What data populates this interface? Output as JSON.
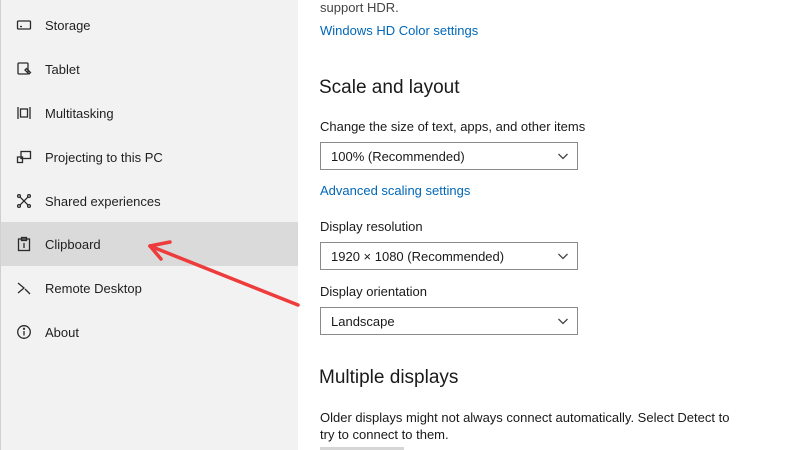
{
  "sidebar": {
    "items": [
      {
        "label": "Storage",
        "icon": "storage-icon"
      },
      {
        "label": "Tablet",
        "icon": "tablet-icon"
      },
      {
        "label": "Multitasking",
        "icon": "multitasking-icon"
      },
      {
        "label": "Projecting to this PC",
        "icon": "projecting-icon"
      },
      {
        "label": "Shared experiences",
        "icon": "shared-experiences-icon"
      },
      {
        "label": "Clipboard",
        "icon": "clipboard-icon"
      },
      {
        "label": "Remote Desktop",
        "icon": "remote-desktop-icon"
      },
      {
        "label": "About",
        "icon": "info-icon"
      }
    ],
    "selected": "Clipboard"
  },
  "main": {
    "hdr_text": "support HDR.",
    "hdr_link": "Windows HD Color settings",
    "scale_section": {
      "title": "Scale and layout",
      "size_label": "Change the size of text, apps, and other items",
      "size_value": "100% (Recommended)",
      "advanced_link": "Advanced scaling settings",
      "resolution_label": "Display resolution",
      "resolution_value": "1920 × 1080 (Recommended)",
      "orientation_label": "Display orientation",
      "orientation_value": "Landscape"
    },
    "multiple_section": {
      "title": "Multiple displays",
      "description": "Older displays might not always connect automatically. Select Detect to try to connect to them."
    }
  },
  "annotation": {
    "arrow_color": "#ee3b3b",
    "points_to": "Clipboard"
  },
  "colors": {
    "sidebar_bg": "#f2f2f2",
    "selected_bg": "#dadada",
    "link": "#0067b8"
  }
}
